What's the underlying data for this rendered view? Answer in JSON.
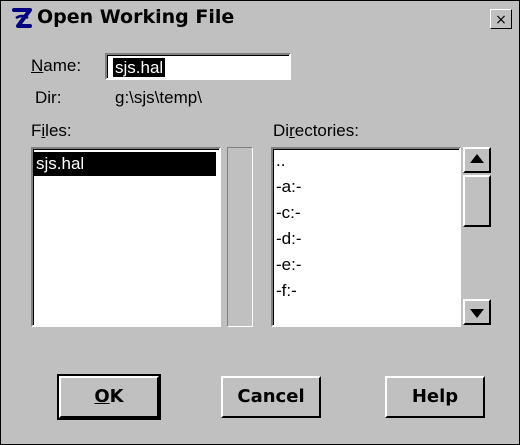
{
  "window": {
    "title": "Open Working File",
    "close_label": "×"
  },
  "name_field": {
    "label_prefix": "",
    "label_underline": "N",
    "label_rest": "ame:",
    "value": "sjs.hal"
  },
  "dir": {
    "label": "Dir:",
    "value": "g:\\sjs\\temp\\"
  },
  "files": {
    "label_prefix": "F",
    "label_underline": "i",
    "label_rest": "les:",
    "items": [
      "sjs.hal"
    ]
  },
  "directories": {
    "label_prefix": "Di",
    "label_underline": "r",
    "label_rest": "ectories:",
    "items": [
      "..",
      "-a:-",
      "-c:-",
      "-d:-",
      "-e:-",
      "-f:-"
    ]
  },
  "buttons": {
    "ok_underline": "O",
    "ok_rest": "K",
    "cancel": "Cancel",
    "help": "Help"
  },
  "icons": {
    "title": "app-logo-icon",
    "scroll_up": "arrow-up-icon",
    "scroll_down": "arrow-down-icon"
  }
}
